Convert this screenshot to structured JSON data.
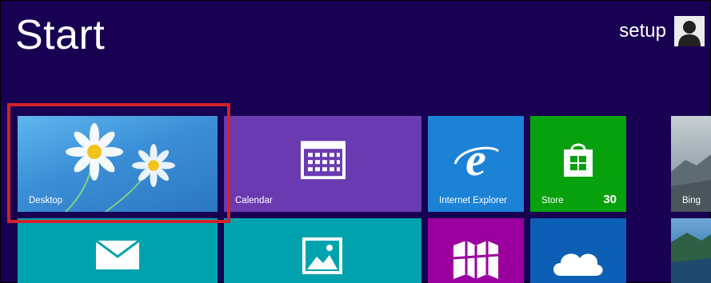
{
  "header": {
    "title": "Start",
    "user_name": "setup",
    "avatar_icon": "user-silhouette-icon"
  },
  "tiles": [
    {
      "id": "desktop",
      "label": "Desktop",
      "color": "#3b8fd6",
      "icon": "daisy-wallpaper"
    },
    {
      "id": "calendar",
      "label": "Calendar",
      "color": "#6a3bb0",
      "icon": "calendar-grid-icon"
    },
    {
      "id": "ie",
      "label": "Internet Explorer",
      "color": "#1c82d6",
      "icon": "internet-explorer-icon"
    },
    {
      "id": "store",
      "label": "Store",
      "badge": "30",
      "color": "#08a10e",
      "icon": "store-bag-icon"
    },
    {
      "id": "bing",
      "label": "Bing",
      "color": "#8fa0a8",
      "icon": "bing-photo"
    },
    {
      "id": "mail",
      "label": "",
      "color": "#00a3ad",
      "icon": "mail-envelope-icon"
    },
    {
      "id": "photos",
      "label": "",
      "color": "#00a3ad",
      "icon": "photos-icon"
    },
    {
      "id": "maps",
      "label": "",
      "color": "#9b009f",
      "icon": "maps-icon"
    },
    {
      "id": "skydrive",
      "label": "",
      "color": "#0c5fb4",
      "icon": "skydrive-cloud-icon"
    },
    {
      "id": "travel",
      "label": "",
      "color": "#2a6fa8",
      "icon": "travel-photo"
    }
  ],
  "selection": {
    "target": "desktop",
    "color": "#d4222b"
  },
  "colors": {
    "background": "#180052"
  }
}
